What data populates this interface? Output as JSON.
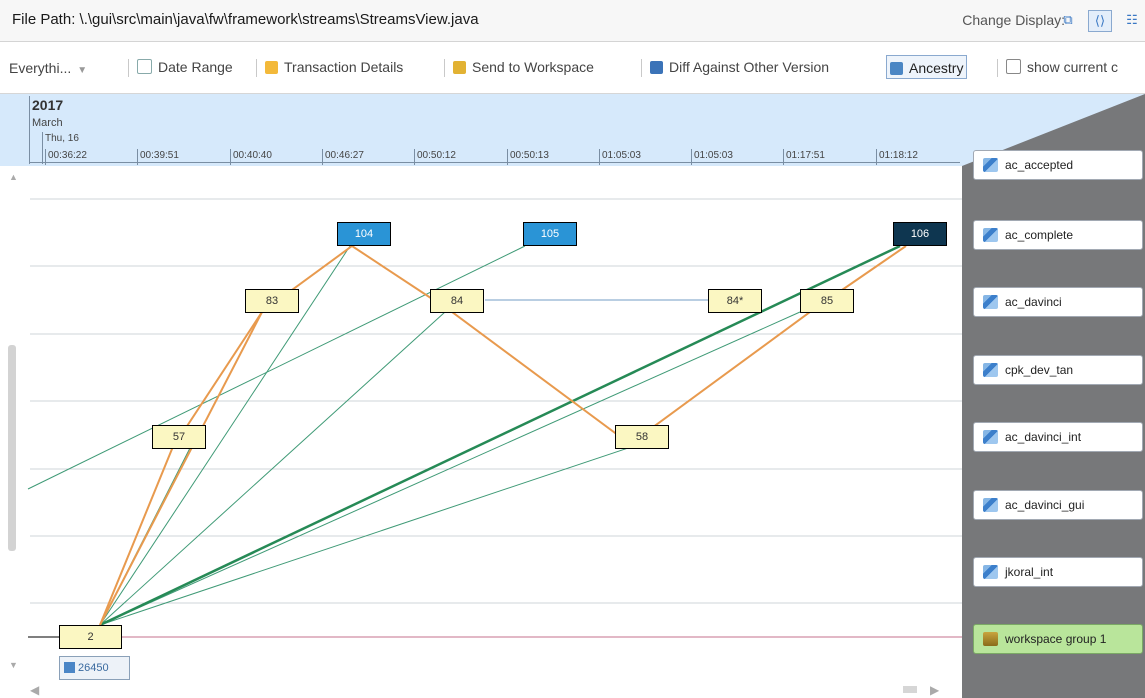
{
  "titlebar": {
    "file_path": "File Path: \\.\\gui\\src\\main\\java\\fw\\framework\\streams\\StreamsView.java",
    "change_display_label": "Change Display:"
  },
  "toolbar": {
    "filter_value": "Everythi...",
    "date_range": "Date Range",
    "transaction_details": "Transaction Details",
    "send_to_workspace": "Send to Workspace",
    "diff_against_other_version": "Diff Against Other Version",
    "ancestry": "Ancestry",
    "show_current": "show current c"
  },
  "timeline": {
    "year": "2017",
    "month": "March",
    "day": "Thu, 16",
    "times": [
      "00:36:22",
      "00:39:51",
      "00:40:40",
      "00:46:27",
      "00:50:12",
      "00:50:13",
      "01:05:03",
      "01:05:03",
      "01:17:51",
      "01:18:12"
    ]
  },
  "streams": [
    {
      "label": "ac_accepted"
    },
    {
      "label": "ac_complete"
    },
    {
      "label": "ac_davinci"
    },
    {
      "label": "cpk_dev_tan"
    },
    {
      "label": "ac_davinci_int"
    },
    {
      "label": "ac_davinci_gui"
    },
    {
      "label": "jkoral_int"
    },
    {
      "label": "workspace group 1"
    }
  ],
  "nodes": {
    "n2": "2",
    "n57": "57",
    "n83": "83",
    "n104": "104",
    "n84": "84",
    "n105": "105",
    "n58": "58",
    "n84s": "84*",
    "n85": "85",
    "n106": "106"
  },
  "transaction_chip": "26450",
  "colors": {
    "timeline_bg": "#d6e9fb",
    "panel_bg": "#77787a",
    "version_yellow": "#fbf7c2",
    "version_blue": "#2a94d6",
    "version_dark": "#0e3650",
    "promote_line": "#e89a4e",
    "ancestry_line": "#3f9a76",
    "workspace_line": "#d9a0b4",
    "workspace_green": "#b9e59b"
  }
}
